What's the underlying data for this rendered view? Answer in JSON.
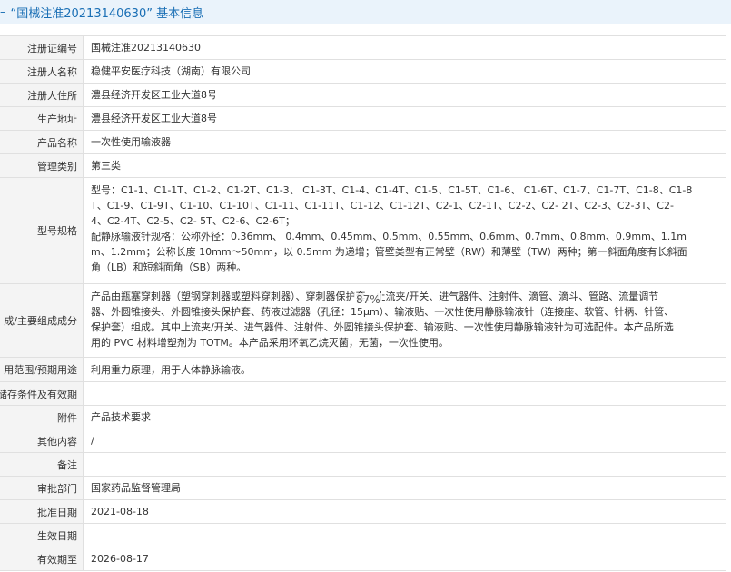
{
  "header": {
    "dash": "–",
    "title": "“国械注准20213140630” 基本信息"
  },
  "rows": [
    {
      "label": "注册证编号",
      "value": "国械注准20213140630"
    },
    {
      "label": "注册人名称",
      "value": "稳健平安医疗科技（湖南）有限公司"
    },
    {
      "label": "注册人住所",
      "value": "澧县经济开发区工业大道8号"
    },
    {
      "label": "生产地址",
      "value": "澧县经济开发区工业大道8号"
    },
    {
      "label": "产品名称",
      "value": "一次性使用输液器"
    },
    {
      "label": "管理类别",
      "value": "第三类"
    },
    {
      "label": "型号规格",
      "lines": [
        "型号：C1-1、C1-1T、C1-2、C1-2T、C1-3、 C1-3T、C1-4、C1-4T、C1-5、C1-5T、C1-6、 C1-6T、C1-7、C1-7T、C1-8、C1-8",
        "T、C1-9、C1-9T、C1-10、C1-10T、C1-11、C1-11T、C1-12、C1-12T、C2-1、C2-1T、C2-2、C2- 2T、C2-3、C2-3T、C2-",
        "4、C2-4T、C2-5、C2- 5T、C2-6、C2-6T；",
        "配静脉输液针规格：公称外径：0.36mm、 0.4mm、0.45mm、0.5mm、0.55mm、0.6mm、0.7mm、0.8mm、0.9mm、1.1m",
        "m、1.2mm；公称长度 10mm～50mm，以 0.5mm 为递增；管壁类型有正常壁（RW）和薄壁（TW）两种；第一斜面角度有长斜面",
        "角（LB）和短斜面角（SB）两种。"
      ]
    },
    {
      "label": "成/主要组成成分",
      "lines": [
        "产品由瓶塞穿刺器（塑钢穿刺器或塑料穿刺器）、穿刺器保护套、止流夹/开关、进气器件、注射件、滴管、滴斗、管路、流量调节",
        "器、外圆锥接头、外圆锥接头保护套、药液过滤器（孔径：15μm）、输液贴、一次性使用静脉输液针（连接座、软管、针柄、针管、",
        "保护套）组成。其中止流夹/开关、进气器件、注射件、外圆锥接头保护套、输液贴、一次性使用静脉输液针为可选配件。本产品所选",
        "用的 PVC 材料增塑剂为 TOTM。本产品采用环氧乙烷灭菌，无菌，一次性使用。"
      ]
    },
    {
      "label": "用范围/预期用途",
      "value": "利用重力原理，用于人体静脉输液。"
    },
    {
      "label": "储存条件及有效期",
      "value": ""
    },
    {
      "label": "附件",
      "value": "产品技术要求"
    },
    {
      "label": "其他内容",
      "value": "/"
    },
    {
      "label": "备注",
      "value": ""
    },
    {
      "label": "审批部门",
      "value": "国家药品监督管理局"
    },
    {
      "label": "批准日期",
      "value": "2021-08-18"
    },
    {
      "label": "生效日期",
      "value": ""
    },
    {
      "label": "有效期至",
      "value": "2026-08-17"
    }
  ],
  "overlay": {
    "zoom": "87%"
  }
}
